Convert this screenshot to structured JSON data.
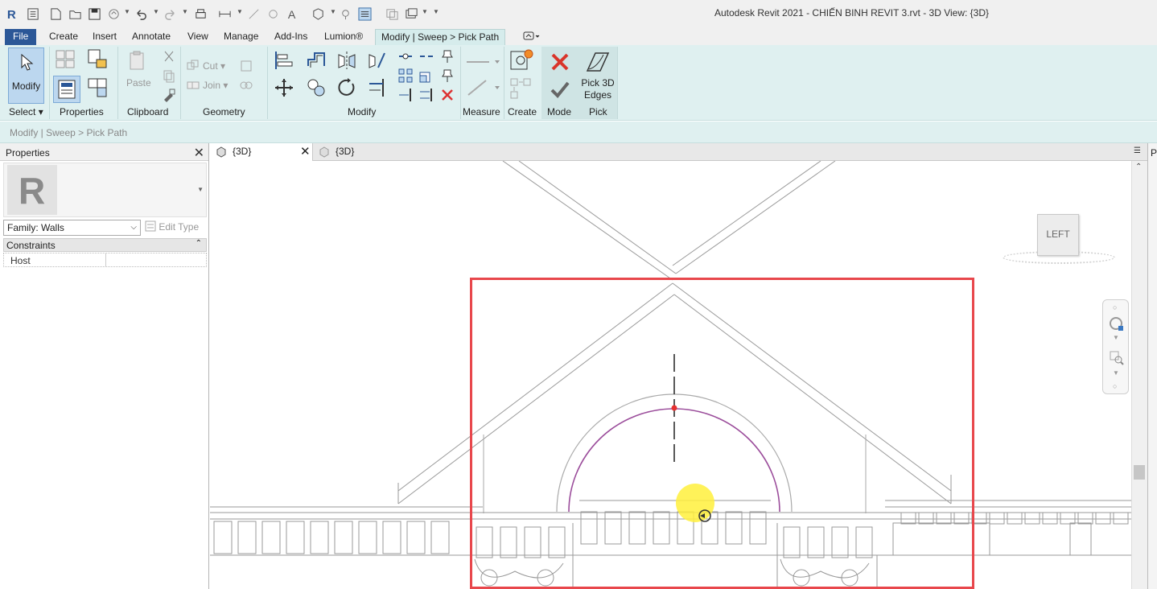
{
  "window": {
    "title": "Autodesk Revit 2021 - CHIẾN BINH REVIT 3.rvt - 3D View: {3D}"
  },
  "ribbon_tabs": [
    {
      "label": "File"
    },
    {
      "label": "Create"
    },
    {
      "label": "Insert"
    },
    {
      "label": "Annotate"
    },
    {
      "label": "View"
    },
    {
      "label": "Manage"
    },
    {
      "label": "Add-Ins"
    },
    {
      "label": "Lumion®"
    },
    {
      "label": "Modify | Sweep > Pick Path"
    }
  ],
  "ribbon": {
    "modify_label": "Modify",
    "paste_label": "Paste",
    "cut_label": "Cut",
    "join_label": "Join",
    "pick_3d_edges_label_1": "Pick 3D",
    "pick_3d_edges_label_2": "Edges",
    "panels": {
      "select": "Select",
      "properties": "Properties",
      "clipboard": "Clipboard",
      "geometry": "Geometry",
      "modify": "Modify",
      "measure": "Measure",
      "create": "Create",
      "mode": "Mode",
      "pick": "Pick"
    }
  },
  "options_bar": {
    "breadcrumb": "Modify | Sweep > Pick Path"
  },
  "properties_palette": {
    "title": "Properties",
    "family_select": "Family: Walls",
    "edit_type": "Edit Type",
    "section": "Constraints",
    "rows": [
      {
        "key": "Host",
        "value": ""
      }
    ]
  },
  "view_tabs": [
    {
      "label": "{3D}",
      "active": true
    },
    {
      "label": "{3D}",
      "active": false
    }
  ],
  "viewcube": {
    "face_label": "LEFT"
  },
  "right_pane": {
    "label": "P"
  },
  "colors": {
    "file_tab": "#2b5797",
    "ribbon_bg": "#dff0f0",
    "highlight_box": "#e8474c",
    "sketch_path": "#9b4d9b",
    "cursor_dot": "#fff03c"
  }
}
